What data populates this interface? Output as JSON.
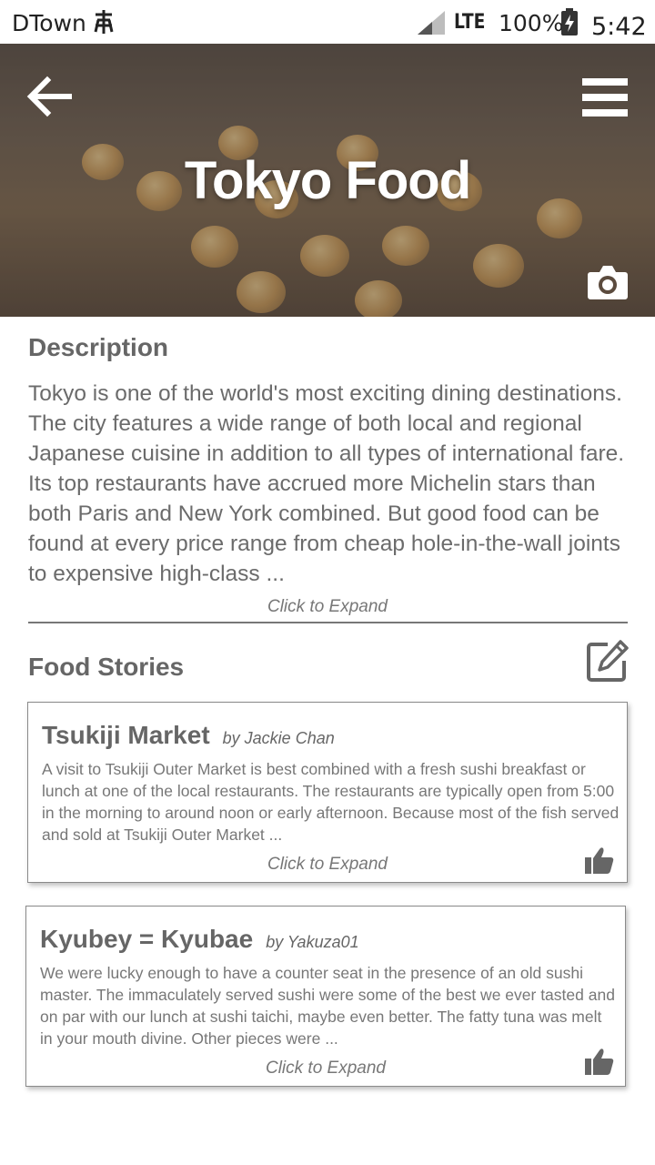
{
  "status_bar": {
    "carrier": "DTown",
    "network": "LTE",
    "battery": "100%",
    "time": "5:42"
  },
  "header": {
    "title": "Tokyo Food",
    "back_icon": "arrow-left-icon",
    "menu_icon": "hamburger-menu-icon",
    "camera_icon": "camera-icon"
  },
  "description": {
    "heading": "Description",
    "text": "Tokyo is one of the world's most exciting dining destinations. The city features a wide range of both local and regional Japanese cuisine in addition to all types of international fare. Its top restaurants have accrued more Michelin stars than both Paris and New York combined. But good food can be found at every price range from cheap hole-in-the-wall joints to expensive high-class ...",
    "expand_label": "Click to Expand"
  },
  "food_stories": {
    "heading": "Food Stories",
    "edit_icon": "edit-icon",
    "stories": [
      {
        "title": "Tsukiji Market",
        "author": "by Jackie Chan",
        "text": "A visit to Tsukiji Outer Market is best combined with a fresh sushi breakfast or lunch at one of the local restaurants. The restaurants are typically open from 5:00 in the morning to around noon or early afternoon. Because most of the fish served and sold at Tsukiji Outer Market ...",
        "expand_label": "Click to Expand"
      },
      {
        "title": "Kyubey = Kyubae",
        "author": "by Yakuza01",
        "text": "We were lucky enough to have a counter seat in the presence of an old sushi master. The immaculately served sushi were some of the best we ever tasted and on par with our lunch at sushi taichi, maybe even better. The fatty tuna was melt in your mouth divine. Other pieces were ...",
        "expand_label": "Click to Expand"
      }
    ]
  },
  "colors": {
    "text": "#666666",
    "accent": "#ffffff"
  }
}
